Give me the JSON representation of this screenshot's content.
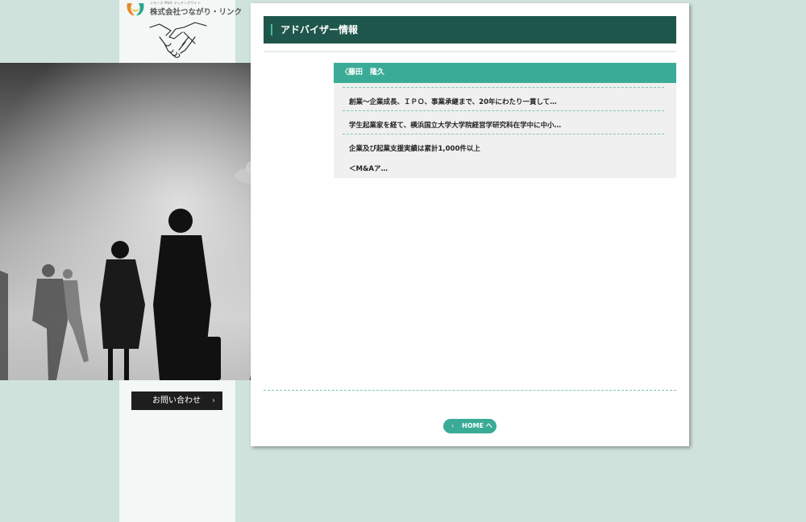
{
  "logo": {
    "tagline": "シモーズ M&A マッチングサイト",
    "company": "株式会社つながり・リンク"
  },
  "contact": {
    "label": "お問い合わせ"
  },
  "page": {
    "title": "アドバイザー情報"
  },
  "advisor": {
    "name": "〈藤田　隆久",
    "items": [
      "創業〜企業成長、ＩＰＯ、事業承継まで、20年にわたり一貫して…",
      "学生起業家を経て、横浜国立大学大学院経営学研究科在学中に中小…",
      "企業及び起業支援実績は累計1,000件以上",
      "＜M&Aア…"
    ]
  },
  "home": {
    "label": "HOME へ"
  },
  "colors": {
    "background": "#cfe2dc",
    "title_bar": "#1f564b",
    "accent": "#3aab96"
  }
}
